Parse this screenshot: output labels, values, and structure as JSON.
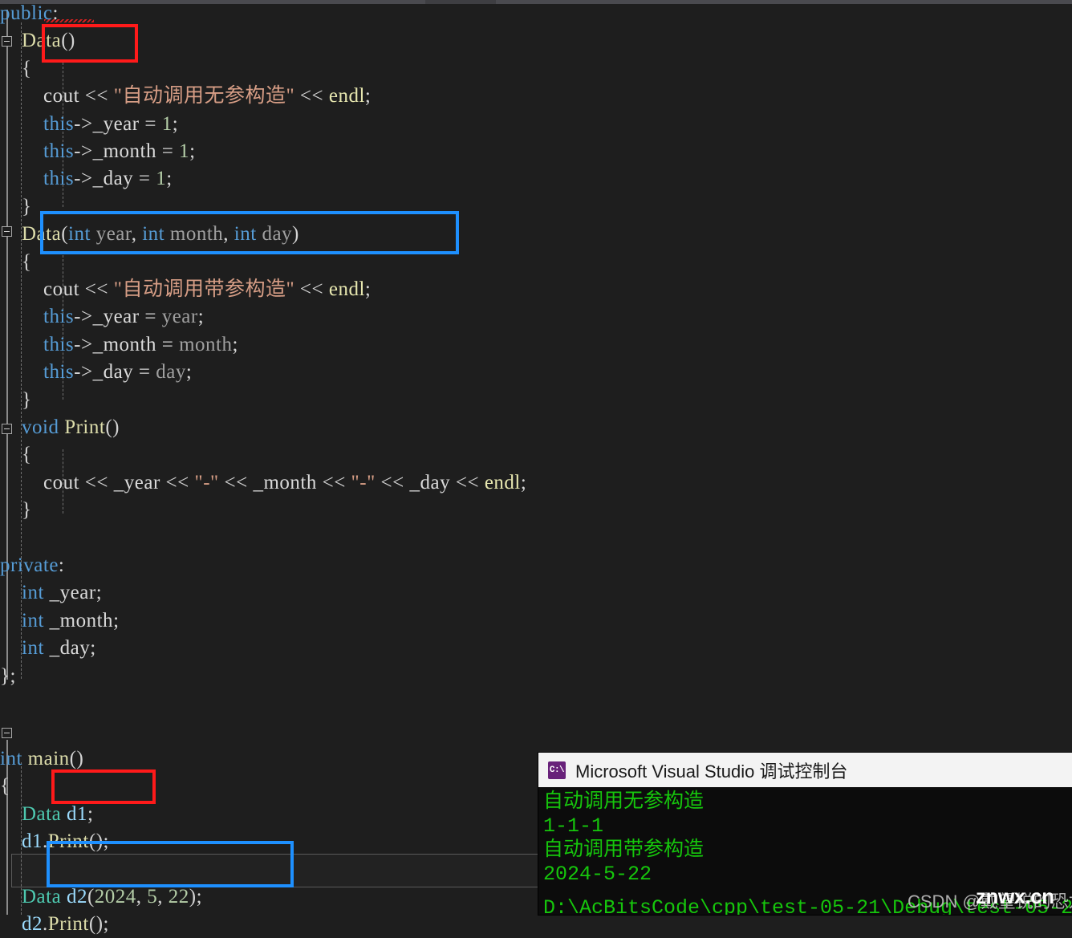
{
  "editor": {
    "background": "#1e1e1e",
    "theme_colors": {
      "keyword": "#569cd6",
      "class_type": "#4ec9b0",
      "function": "#dcdcaa",
      "string": "#d69d85",
      "number": "#b5cea8",
      "identifier": "#dadada",
      "variable": "#9cdcfe",
      "parameter": "#a0a0a0"
    },
    "highlight_boxes": [
      {
        "color": "#ff1a1a",
        "target": "Data()"
      },
      {
        "color": "#1e90ff",
        "target": "Data(int year, int month, int day)"
      },
      {
        "color": "#ff1a1a",
        "target": "Data d1;"
      },
      {
        "color": "#1e90ff",
        "target": "Data d2(2024, 5, 22);"
      }
    ],
    "lines": [
      {
        "n": 0,
        "tokens": [
          {
            "t": "public",
            "c": "kw"
          },
          {
            "t": ":",
            "c": "pl"
          }
        ]
      },
      {
        "n": 1,
        "tokens": [
          {
            "t": "    ",
            "c": "pl"
          },
          {
            "t": "Data",
            "c": "fn"
          },
          {
            "t": "()",
            "c": "pl"
          }
        ]
      },
      {
        "n": 2,
        "tokens": [
          {
            "t": "    {",
            "c": "pl"
          }
        ]
      },
      {
        "n": 3,
        "tokens": [
          {
            "t": "        ",
            "c": "pl"
          },
          {
            "t": "cout",
            "c": "id"
          },
          {
            "t": " << ",
            "c": "op"
          },
          {
            "t": "\"自动调用无参构造\"",
            "c": "str"
          },
          {
            "t": " << ",
            "c": "op"
          },
          {
            "t": "endl",
            "c": "endl"
          },
          {
            "t": ";",
            "c": "pl"
          }
        ]
      },
      {
        "n": 4,
        "tokens": [
          {
            "t": "        ",
            "c": "pl"
          },
          {
            "t": "this",
            "c": "kw"
          },
          {
            "t": "->",
            "c": "op"
          },
          {
            "t": "_year",
            "c": "id"
          },
          {
            "t": " = ",
            "c": "op"
          },
          {
            "t": "1",
            "c": "num"
          },
          {
            "t": ";",
            "c": "pl"
          }
        ]
      },
      {
        "n": 5,
        "tokens": [
          {
            "t": "        ",
            "c": "pl"
          },
          {
            "t": "this",
            "c": "kw"
          },
          {
            "t": "->",
            "c": "op"
          },
          {
            "t": "_month",
            "c": "id"
          },
          {
            "t": " = ",
            "c": "op"
          },
          {
            "t": "1",
            "c": "num"
          },
          {
            "t": ";",
            "c": "pl"
          }
        ]
      },
      {
        "n": 6,
        "tokens": [
          {
            "t": "        ",
            "c": "pl"
          },
          {
            "t": "this",
            "c": "kw"
          },
          {
            "t": "->",
            "c": "op"
          },
          {
            "t": "_day",
            "c": "id"
          },
          {
            "t": " = ",
            "c": "op"
          },
          {
            "t": "1",
            "c": "num"
          },
          {
            "t": ";",
            "c": "pl"
          }
        ]
      },
      {
        "n": 7,
        "tokens": [
          {
            "t": "    }",
            "c": "pl"
          }
        ]
      },
      {
        "n": 8,
        "tokens": [
          {
            "t": "    ",
            "c": "pl"
          },
          {
            "t": "Data",
            "c": "fn"
          },
          {
            "t": "(",
            "c": "pl"
          },
          {
            "t": "int",
            "c": "kw"
          },
          {
            "t": " year",
            "c": "parm"
          },
          {
            "t": ", ",
            "c": "pl"
          },
          {
            "t": "int",
            "c": "kw"
          },
          {
            "t": " month",
            "c": "parm"
          },
          {
            "t": ", ",
            "c": "pl"
          },
          {
            "t": "int",
            "c": "kw"
          },
          {
            "t": " day",
            "c": "parm"
          },
          {
            "t": ")",
            "c": "pl"
          }
        ]
      },
      {
        "n": 9,
        "tokens": [
          {
            "t": "    {",
            "c": "pl"
          }
        ]
      },
      {
        "n": 10,
        "tokens": [
          {
            "t": "        ",
            "c": "pl"
          },
          {
            "t": "cout",
            "c": "id"
          },
          {
            "t": " << ",
            "c": "op"
          },
          {
            "t": "\"自动调用带参构造\"",
            "c": "str"
          },
          {
            "t": " << ",
            "c": "op"
          },
          {
            "t": "endl",
            "c": "endl"
          },
          {
            "t": ";",
            "c": "pl"
          }
        ]
      },
      {
        "n": 11,
        "tokens": [
          {
            "t": "        ",
            "c": "pl"
          },
          {
            "t": "this",
            "c": "kw"
          },
          {
            "t": "->",
            "c": "op"
          },
          {
            "t": "_year",
            "c": "id"
          },
          {
            "t": " = ",
            "c": "op"
          },
          {
            "t": "year",
            "c": "parm"
          },
          {
            "t": ";",
            "c": "pl"
          }
        ]
      },
      {
        "n": 12,
        "tokens": [
          {
            "t": "        ",
            "c": "pl"
          },
          {
            "t": "this",
            "c": "kw"
          },
          {
            "t": "->",
            "c": "op"
          },
          {
            "t": "_month",
            "c": "id"
          },
          {
            "t": " = ",
            "c": "op"
          },
          {
            "t": "month",
            "c": "parm"
          },
          {
            "t": ";",
            "c": "pl"
          }
        ]
      },
      {
        "n": 13,
        "tokens": [
          {
            "t": "        ",
            "c": "pl"
          },
          {
            "t": "this",
            "c": "kw"
          },
          {
            "t": "->",
            "c": "op"
          },
          {
            "t": "_day",
            "c": "id"
          },
          {
            "t": " = ",
            "c": "op"
          },
          {
            "t": "day",
            "c": "parm"
          },
          {
            "t": ";",
            "c": "pl"
          }
        ]
      },
      {
        "n": 14,
        "tokens": [
          {
            "t": "    }",
            "c": "pl"
          }
        ]
      },
      {
        "n": 15,
        "tokens": [
          {
            "t": "    ",
            "c": "pl"
          },
          {
            "t": "void",
            "c": "kw"
          },
          {
            "t": " ",
            "c": "pl"
          },
          {
            "t": "Print",
            "c": "fn"
          },
          {
            "t": "()",
            "c": "pl"
          }
        ]
      },
      {
        "n": 16,
        "tokens": [
          {
            "t": "    {",
            "c": "pl"
          }
        ]
      },
      {
        "n": 17,
        "tokens": [
          {
            "t": "        ",
            "c": "pl"
          },
          {
            "t": "cout",
            "c": "id"
          },
          {
            "t": " << ",
            "c": "op"
          },
          {
            "t": "_year",
            "c": "id"
          },
          {
            "t": " << ",
            "c": "op"
          },
          {
            "t": "\"-\"",
            "c": "str"
          },
          {
            "t": " << ",
            "c": "op"
          },
          {
            "t": "_month",
            "c": "id"
          },
          {
            "t": " << ",
            "c": "op"
          },
          {
            "t": "\"-\"",
            "c": "str"
          },
          {
            "t": " << ",
            "c": "op"
          },
          {
            "t": "_day",
            "c": "id"
          },
          {
            "t": " << ",
            "c": "op"
          },
          {
            "t": "endl",
            "c": "endl"
          },
          {
            "t": ";",
            "c": "pl"
          }
        ]
      },
      {
        "n": 18,
        "tokens": [
          {
            "t": "    }",
            "c": "pl"
          }
        ]
      },
      {
        "n": 19,
        "tokens": [
          {
            "t": "",
            "c": "pl"
          }
        ]
      },
      {
        "n": 20,
        "tokens": [
          {
            "t": "private",
            "c": "kw"
          },
          {
            "t": ":",
            "c": "pl"
          }
        ]
      },
      {
        "n": 21,
        "tokens": [
          {
            "t": "    ",
            "c": "pl"
          },
          {
            "t": "int",
            "c": "kw"
          },
          {
            "t": " _year",
            "c": "id"
          },
          {
            "t": ";",
            "c": "pl"
          }
        ]
      },
      {
        "n": 22,
        "tokens": [
          {
            "t": "    ",
            "c": "pl"
          },
          {
            "t": "int",
            "c": "kw"
          },
          {
            "t": " _month",
            "c": "id"
          },
          {
            "t": ";",
            "c": "pl"
          }
        ]
      },
      {
        "n": 23,
        "tokens": [
          {
            "t": "    ",
            "c": "pl"
          },
          {
            "t": "int",
            "c": "kw"
          },
          {
            "t": " _day",
            "c": "id"
          },
          {
            "t": ";",
            "c": "pl"
          }
        ]
      },
      {
        "n": 24,
        "tokens": [
          {
            "t": "};",
            "c": "pl"
          }
        ]
      },
      {
        "n": 25,
        "tokens": [
          {
            "t": "",
            "c": "pl"
          }
        ]
      },
      {
        "n": 26,
        "tokens": [
          {
            "t": "",
            "c": "pl"
          }
        ]
      },
      {
        "n": 27,
        "tokens": [
          {
            "t": "int",
            "c": "kw"
          },
          {
            "t": " ",
            "c": "pl"
          },
          {
            "t": "main",
            "c": "fn"
          },
          {
            "t": "()",
            "c": "pl"
          }
        ]
      },
      {
        "n": 28,
        "tokens": [
          {
            "t": "{",
            "c": "pl"
          }
        ]
      },
      {
        "n": 29,
        "tokens": [
          {
            "t": "    ",
            "c": "pl"
          },
          {
            "t": "Data",
            "c": "cls"
          },
          {
            "t": " ",
            "c": "pl"
          },
          {
            "t": "d1",
            "c": "var"
          },
          {
            "t": ";",
            "c": "pl"
          }
        ]
      },
      {
        "n": 30,
        "tokens": [
          {
            "t": "    ",
            "c": "pl"
          },
          {
            "t": "d1",
            "c": "var"
          },
          {
            "t": ".",
            "c": "pl"
          },
          {
            "t": "Print",
            "c": "fn"
          },
          {
            "t": "();",
            "c": "pl"
          }
        ]
      },
      {
        "n": 31,
        "tokens": [
          {
            "t": "",
            "c": "pl"
          }
        ]
      },
      {
        "n": 32,
        "tokens": [
          {
            "t": "    ",
            "c": "pl"
          },
          {
            "t": "Data",
            "c": "cls"
          },
          {
            "t": " ",
            "c": "pl"
          },
          {
            "t": "d2",
            "c": "var"
          },
          {
            "t": "(",
            "c": "pl"
          },
          {
            "t": "2024",
            "c": "num"
          },
          {
            "t": ", ",
            "c": "pl"
          },
          {
            "t": "5",
            "c": "num"
          },
          {
            "t": ", ",
            "c": "pl"
          },
          {
            "t": "22",
            "c": "num"
          },
          {
            "t": ");",
            "c": "pl"
          }
        ]
      },
      {
        "n": 33,
        "tokens": [
          {
            "t": "    ",
            "c": "pl"
          },
          {
            "t": "d2",
            "c": "var"
          },
          {
            "t": ".",
            "c": "pl"
          },
          {
            "t": "Print",
            "c": "fn"
          },
          {
            "t": "();",
            "c": "pl"
          }
        ]
      }
    ]
  },
  "console": {
    "title": "Microsoft Visual Studio 调试控制台",
    "icon": "command-prompt-icon",
    "icon_glyph": "C:\\",
    "background": "#0c0c0c",
    "text_color": "#16c60c",
    "output_lines": [
      "自动调用无参构造",
      "1-1-1",
      "自动调用带参构造",
      "2024-5-22"
    ],
    "tail_line": "D:\\AcBitsCode\\cpp\\test-05-21\\Debug\\test-05-2"
  },
  "watermark": {
    "csdn": "CSDN @戴望锐的恐龙",
    "overlay": "znwx.cn"
  }
}
